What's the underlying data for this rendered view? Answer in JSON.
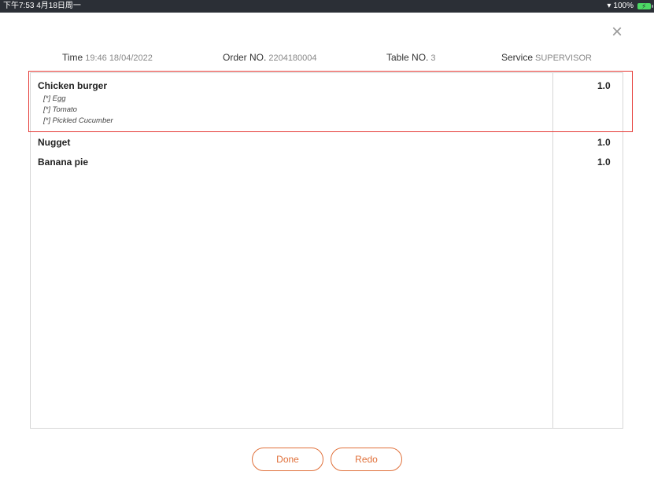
{
  "status_bar": {
    "time_date": "下午7:53  4月18日周一",
    "battery": "100%"
  },
  "header": {
    "close_symbol": "×",
    "time_label": "Time",
    "time_value": "19:46 18/04/2022",
    "order_label": "Order NO.",
    "order_value": "2204180004",
    "table_label": "Table NO.",
    "table_value": "3",
    "service_label": "Service",
    "service_value": "SUPERVISOR"
  },
  "items": [
    {
      "name": "Chicken burger",
      "qty": "1.0",
      "modifiers": [
        "[*] Egg",
        "[*] Tomato",
        "[*] Pickled Cucumber"
      ]
    },
    {
      "name": "Nugget",
      "qty": "1.0",
      "modifiers": []
    },
    {
      "name": "Banana pie",
      "qty": "1.0",
      "modifiers": []
    }
  ],
  "buttons": {
    "done_label": "Done",
    "redo_label": "Redo"
  },
  "colors": {
    "accent": "#e0703a",
    "highlight": "#e53935",
    "status_bar": "#2b2f36"
  }
}
